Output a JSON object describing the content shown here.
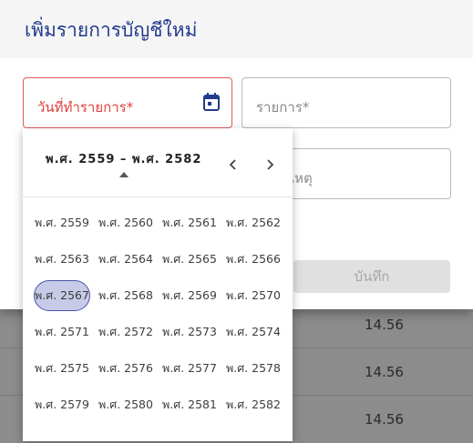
{
  "dialog": {
    "title": "เพิ่มรายการบัญชีใหม่",
    "fields": {
      "date_label": "วันที่ทำรายการ*",
      "item_label": "รายการ*",
      "note_partial": "เหตุ"
    },
    "save_label": "บันทึก"
  },
  "background_table": {
    "values": [
      "14.56",
      "14.56",
      "14.56"
    ]
  },
  "year_picker": {
    "range_label": "พ.ศ. 2559 – พ.ศ. 2582",
    "selected": "พ.ศ. 2567",
    "years": [
      "พ.ศ. 2559",
      "พ.ศ. 2560",
      "พ.ศ. 2561",
      "พ.ศ. 2562",
      "พ.ศ. 2563",
      "พ.ศ. 2564",
      "พ.ศ. 2565",
      "พ.ศ. 2566",
      "พ.ศ. 2567",
      "พ.ศ. 2568",
      "พ.ศ. 2569",
      "พ.ศ. 2570",
      "พ.ศ. 2571",
      "พ.ศ. 2572",
      "พ.ศ. 2573",
      "พ.ศ. 2574",
      "พ.ศ. 2575",
      "พ.ศ. 2576",
      "พ.ศ. 2577",
      "พ.ศ. 2578",
      "พ.ศ. 2579",
      "พ.ศ. 2580",
      "พ.ศ. 2581",
      "พ.ศ. 2582"
    ]
  },
  "colors": {
    "title": "#233a8c",
    "error": "#e0413c",
    "selected_fill": "#c7cbe7",
    "selected_border": "#4b55a8"
  },
  "icons": {
    "date_field": "calendar-icon",
    "prev": "chevron-left-icon",
    "next": "chevron-right-icon",
    "range_toggle": "caret-up-icon"
  }
}
